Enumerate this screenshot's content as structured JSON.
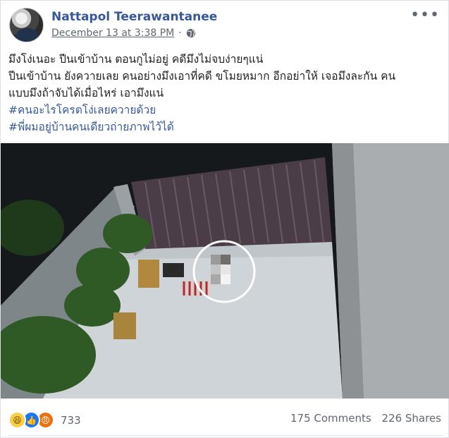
{
  "post": {
    "author": "Nattapol Teerawantanee",
    "timestamp": "December 13 at 3:38 PM",
    "privacy_icon": "globe-icon",
    "more_icon": "more-options-icon",
    "text_lines": [
      "มึงโง่เนอะ ปีนเข้าบ้าน ตอนกูไม่อยู่ คดีมึงไม่จบง่ายๆแน่",
      "ปีนเข้าบ้าน ยังควายเลย คนอย่างมึงเอาที่คดี ขโมยหมาก อีกอย่าให้ เจอมึงละกัน คน",
      "แบบมึงถ้าจับได้เมื่อไหร่ เอามึงแน่"
    ],
    "hashtags": [
      "#คนอะไรโครตโง่เลยควายด้วย",
      "#พี่ผมอยู่บ้านคนเดียวถ่ายภาพไว้ได้"
    ]
  },
  "media": {
    "description_icon": "cctv-photo",
    "colors": {
      "night": "#1b1f22",
      "floor": "#cdd2d6",
      "fence": "#4a3f48",
      "highlight_ring": "#ffffff"
    }
  },
  "footer": {
    "reaction_icons": [
      "haha-icon",
      "like-icon",
      "angry-icon"
    ],
    "reaction_count": "733",
    "comments": "175 Comments",
    "shares": "226 Shares"
  }
}
